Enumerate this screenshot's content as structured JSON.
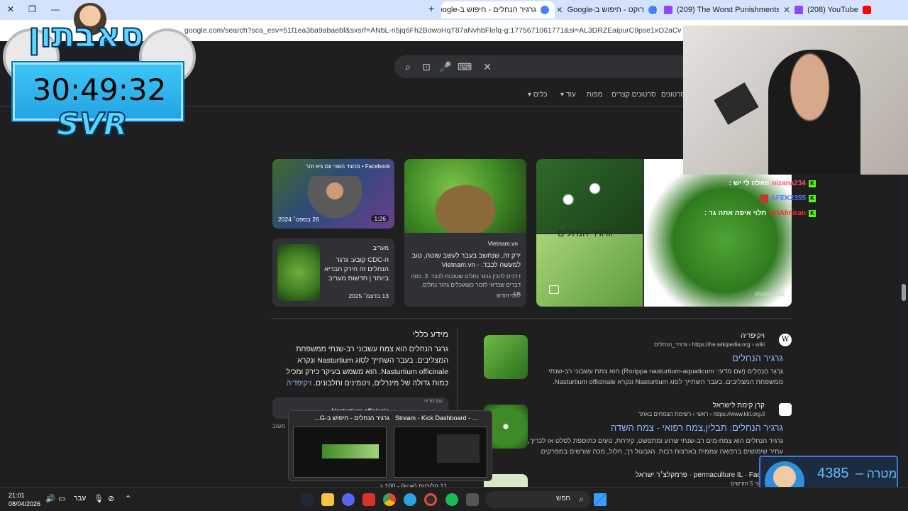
{
  "browser": {
    "tabs": [
      {
        "title": "גרגיר הנחלים - חיפוש ב-Google",
        "active": true
      },
      {
        "title": "רוקט - חיפוש ב-Google",
        "active": false
      },
      {
        "title": "(209) The Worst Punishments in",
        "active": false
      },
      {
        "title": "(208) YouTube",
        "active": false
      }
    ],
    "new_tab": "+",
    "url": "google.com/search?sca_esv=51f1ea3ba9abaebf&sxsrf=ANbL-n5jq6Fh2BowoHqT87aNvhbFlefq-g:1775671061771&si=AL3DRZEaipurC9pse1xO2aCwuJWfKA_Njx1c7Qs8a"
  },
  "google": {
    "nav": [
      "כלים",
      "עוד",
      "מפות",
      "סרטונים קצרים",
      "סרטונים"
    ],
    "colors": {
      "link": "#8ab4f8",
      "bg": "#1f1f1f"
    }
  },
  "images": {
    "facebook_card": {
      "source": "Facebook • מהצד השני עם גיא זהר",
      "date": "26 בספט׳ 2024",
      "duration": "1:26"
    },
    "vietnam_card": {
      "source": "Vietnam.vn",
      "title": "ירק זה, שנחשב בעבר לעשב שוטה, טוב למעשה לכבד. - Vietnam.vn",
      "snippet": "דרכים להכין גרגר נחלים שטובות לכבד. 3. כמה דברים שכדאי לזכור כשאוכלים גרגר נחלים. גרג...",
      "time": "לפני חודש"
    },
    "maariv_card": {
      "source": "מעריב",
      "title": "ה-CDC קובע: גרגר הנחלים זה הירק הבריא ביותר | חדשות מעריב",
      "date": "13 בדצמ׳ 2025"
    },
    "large_card": {
      "label": "גרגיר הנחלים",
      "watermark": "Weebly Clip"
    }
  },
  "results": [
    {
      "site": "ויקיפדיה",
      "url": "https://he.wikipedia.org › wiki › גרגיר_הנחלים",
      "title": "גרגיר הנחלים",
      "snippet": "גַּרְגֵּר הַנְּחָלִים (שם מדעי: Rorippa nasturtium-aquaticum) הוא צמח עשבוני רב-שנתי ממשפחת המצליבים. בעבר השתייך לסוג Nasturtium ונקרא Nasturtium officinale."
    },
    {
      "site": "קרן קימת לישראל",
      "url": "https://www.kkl.org.il › ראשי › רשימת הצמחים באתר",
      "title": "גרגיר הנחלים: תבלין,צמח רפואי - צמח השדה",
      "snippet": "גרגיר הנחלים הוא צמח-מים רב-שנתי שרוע ומתפשט, קירחת, טעים כתוספת לסלט או לכריך, עתיר שימושים ברפואה עממית בארצות רבות. הגבעול רך, חלול, מכה שורשים במפרקים. העלה ..."
    },
    {
      "site": "permaculture IL · Face · פרמקלצ׳ר ישראל",
      "url": "לפני 5 חודשים",
      "title": "",
      "snippet": ""
    }
  ],
  "knowledge": {
    "title": "מידע כללי",
    "text": "גרגר הנחלים הוא צמח עשבוני רב-שנתי ממשפחת המצליבים. בעבר השתייך לסוג Nasturtium ונקרא Nasturtium officinale. הוא משמש בעיקר כירק ומכיל כמות גדולה של מינרלים, ויטמינים וחלבונים.",
    "link": "ויקיפדיה",
    "chip_label": "שם מדעי",
    "chip_value": "Nasturtium officinale",
    "side_label": "משוב",
    "calories": "11 קלוריות (kcal) - 100 ג"
  },
  "overlay": {
    "brand": "סאבתון",
    "timer": "30:49:32",
    "svr": "SVR",
    "chat": [
      {
        "user": "nizana234",
        "text": "וואלה לי יש :"
      },
      {
        "user": "AFEK2355",
        "text": ""
      },
      {
        "user": "OriAlmiran",
        "text": "תלוי איפה אתה גר :"
      }
    ],
    "goal": {
      "label": "מטרה",
      "value": "4385",
      "sub": "4357"
    }
  },
  "popup": {
    "items": [
      {
        "title": "גרגיר הנחלים - חיפוש ב-G..."
      },
      {
        "title": "Stream - Kick Dashboard - ..."
      }
    ]
  },
  "taskbar": {
    "time": "21:01",
    "date": "08/04/2026",
    "lang": "עבר",
    "search": "חפש"
  }
}
